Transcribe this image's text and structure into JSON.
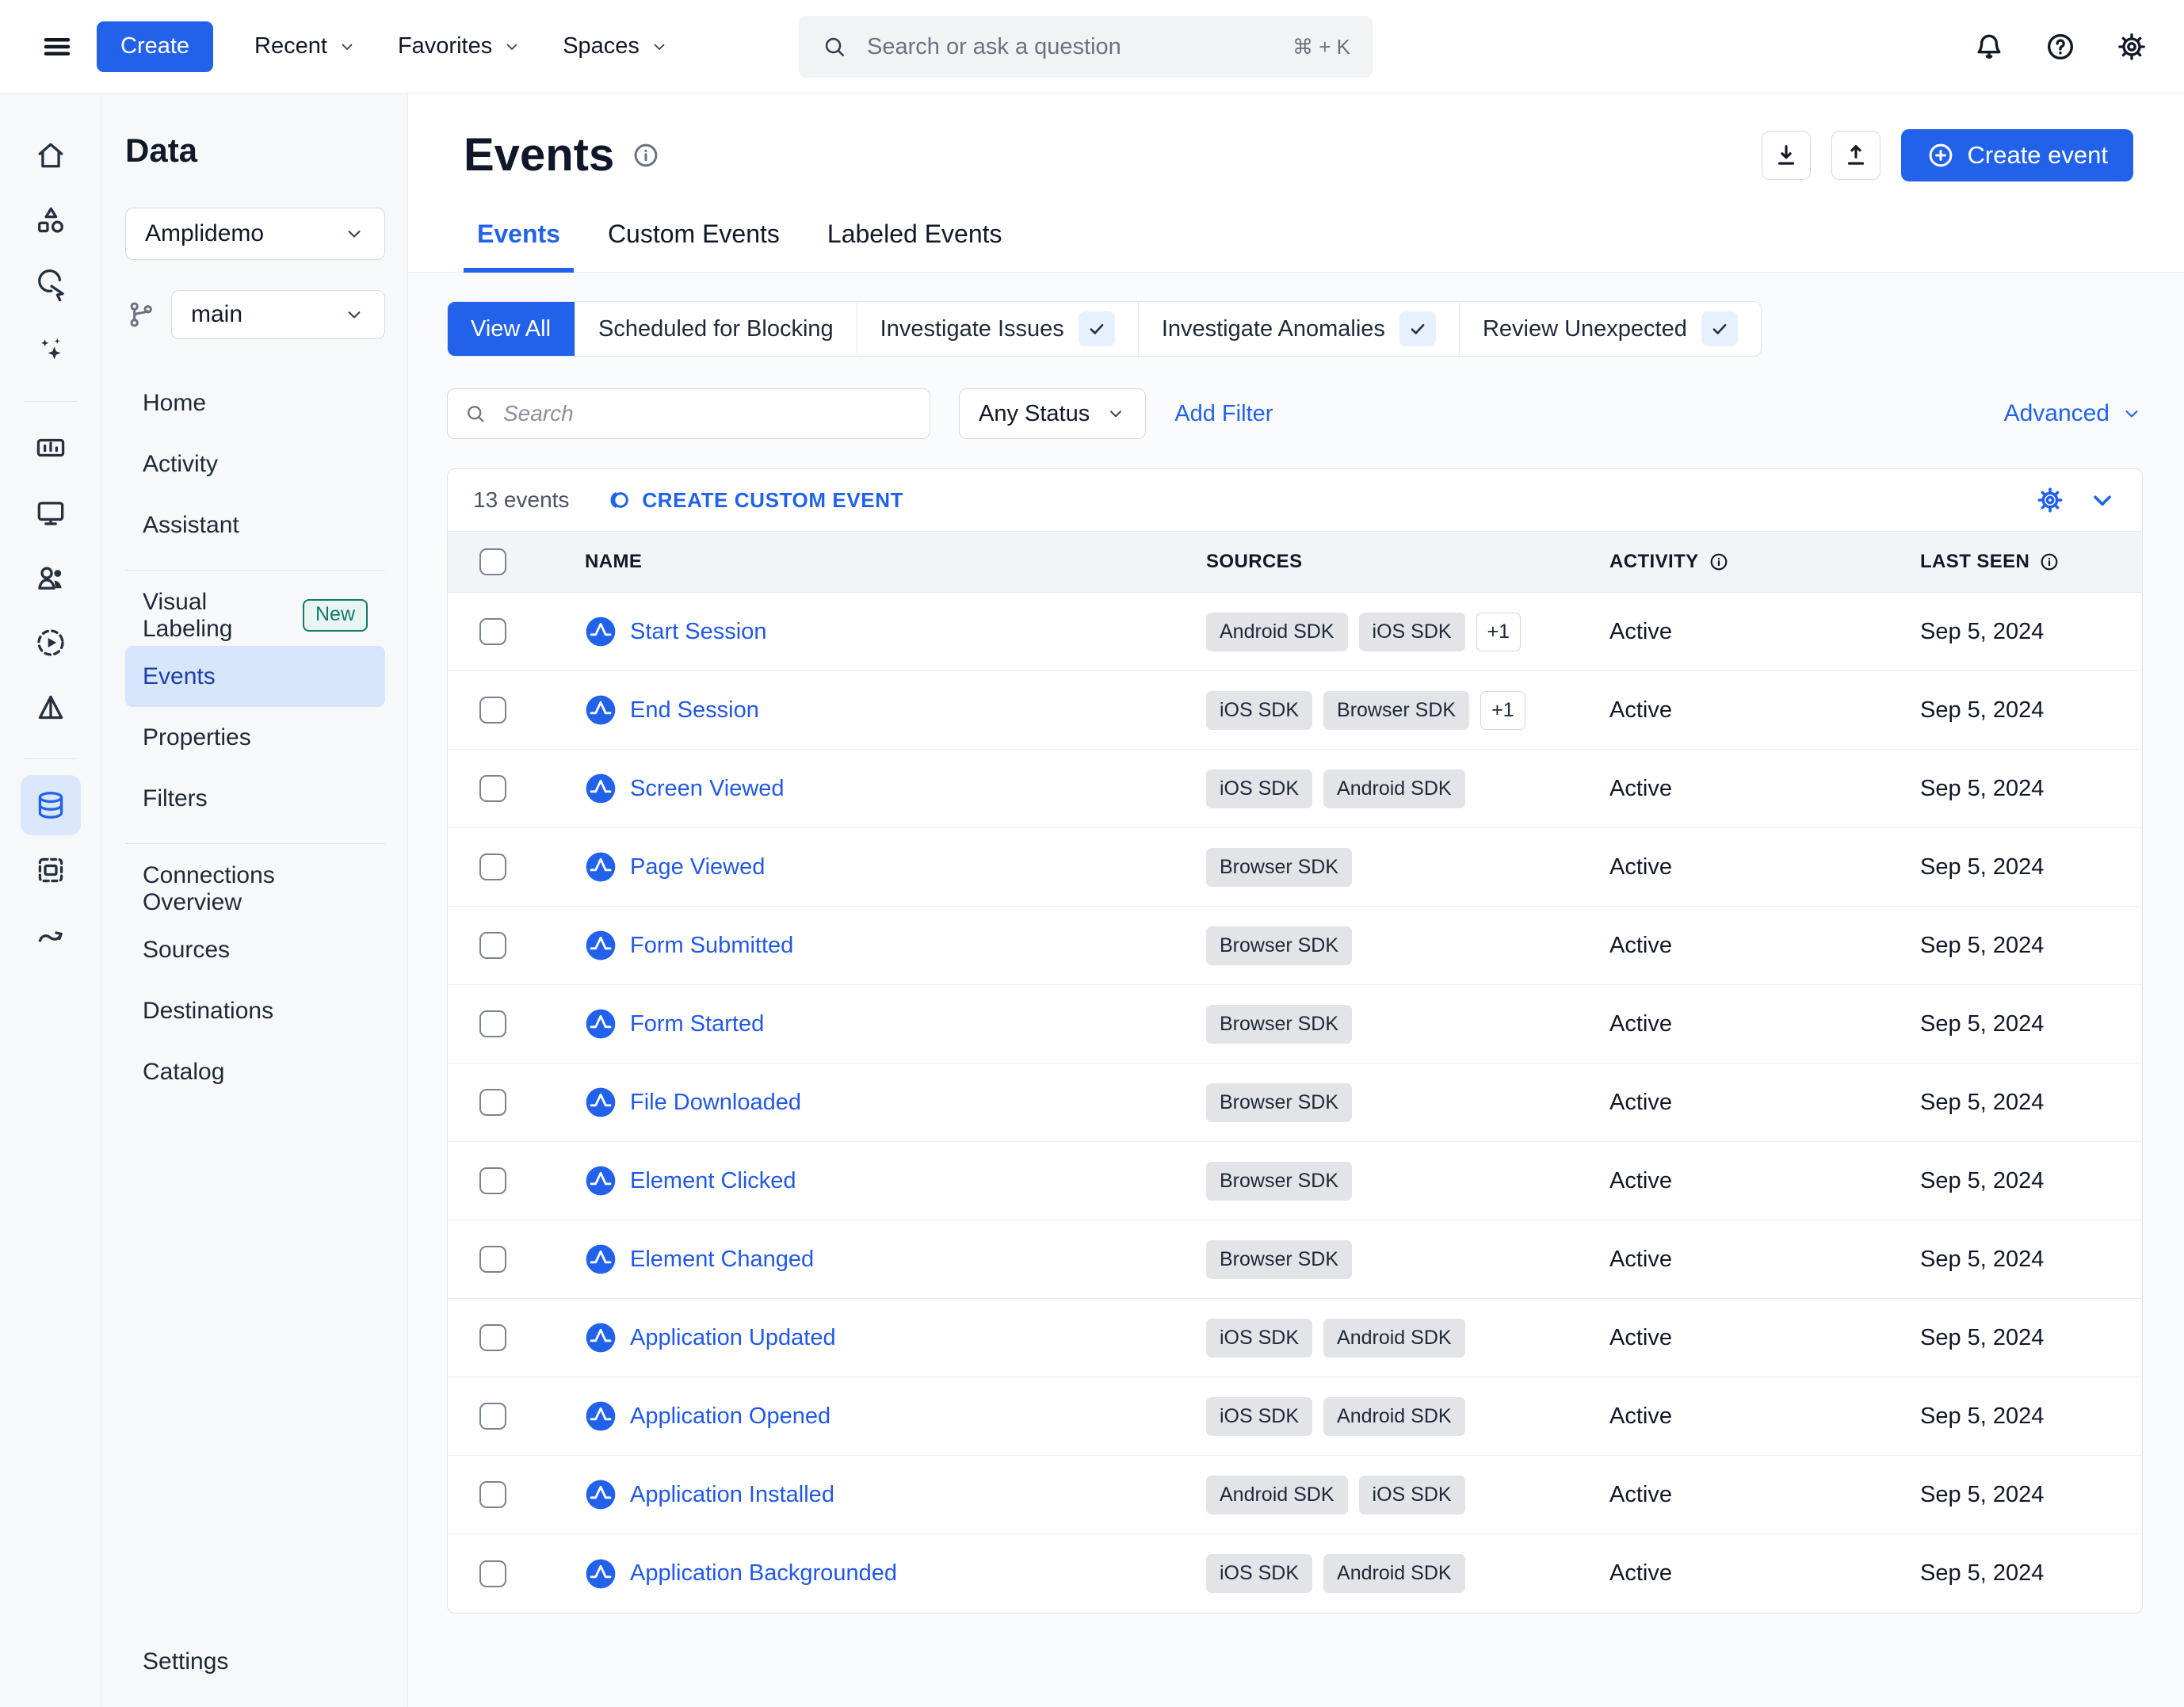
{
  "topbar": {
    "create_label": "Create",
    "nav": [
      {
        "label": "Recent"
      },
      {
        "label": "Favorites"
      },
      {
        "label": "Spaces"
      }
    ],
    "search_placeholder": "Search or ask a question",
    "search_shortcut": "⌘ + K",
    "right_icons": [
      "bell-icon",
      "help-icon",
      "gear-icon"
    ]
  },
  "rail": {
    "items": [
      {
        "icon": "home"
      },
      {
        "icon": "objects"
      },
      {
        "icon": "pointer-click"
      },
      {
        "icon": "ai-sparkles"
      },
      {
        "divider": true
      },
      {
        "icon": "charts"
      },
      {
        "icon": "displays"
      },
      {
        "icon": "users"
      },
      {
        "icon": "session-replay"
      },
      {
        "icon": "experiment"
      },
      {
        "divider": true
      },
      {
        "icon": "data",
        "active": true
      },
      {
        "icon": "labels"
      },
      {
        "icon": "journeys"
      }
    ]
  },
  "sidebar": {
    "title": "Data",
    "project": "Amplidemo",
    "branch": "main",
    "items": [
      {
        "label": "Home"
      },
      {
        "label": "Activity"
      },
      {
        "label": "Assistant"
      },
      {
        "divider": true
      },
      {
        "label": "Visual Labeling",
        "badge": "New"
      },
      {
        "label": "Events",
        "active": true
      },
      {
        "label": "Properties"
      },
      {
        "label": "Filters"
      },
      {
        "divider": true
      },
      {
        "label": "Connections Overview"
      },
      {
        "label": "Sources"
      },
      {
        "label": "Destinations"
      },
      {
        "label": "Catalog"
      }
    ],
    "settings_label": "Settings"
  },
  "page": {
    "title": "Events",
    "create_event_label": "Create event",
    "tabs": [
      {
        "label": "Events",
        "active": true
      },
      {
        "label": "Custom Events"
      },
      {
        "label": "Labeled Events"
      }
    ]
  },
  "filters": {
    "segments": [
      {
        "label": "View All",
        "active": true
      },
      {
        "label": "Scheduled for Blocking"
      },
      {
        "label": "Investigate Issues",
        "check": true
      },
      {
        "label": "Investigate Anomalies",
        "check": true
      },
      {
        "label": "Review Unexpected",
        "check": true
      }
    ],
    "search_placeholder": "Search",
    "status_label": "Any Status",
    "add_filter_label": "Add Filter",
    "advanced_label": "Advanced"
  },
  "table": {
    "count_label": "13 events",
    "create_custom_label": "CREATE CUSTOM EVENT",
    "columns": [
      "NAME",
      "SOURCES",
      "ACTIVITY",
      "LAST SEEN"
    ],
    "rows": [
      {
        "name": "Start Session",
        "sources": [
          "Android SDK",
          "iOS SDK"
        ],
        "more": "+1",
        "activity": "Active",
        "last_seen": "Sep 5, 2024"
      },
      {
        "name": "End Session",
        "sources": [
          "iOS SDK",
          "Browser SDK"
        ],
        "more": "+1",
        "activity": "Active",
        "last_seen": "Sep 5, 2024"
      },
      {
        "name": "Screen Viewed",
        "sources": [
          "iOS SDK",
          "Android SDK"
        ],
        "activity": "Active",
        "last_seen": "Sep 5, 2024"
      },
      {
        "name": "Page Viewed",
        "sources": [
          "Browser SDK"
        ],
        "activity": "Active",
        "last_seen": "Sep 5, 2024"
      },
      {
        "name": "Form Submitted",
        "sources": [
          "Browser SDK"
        ],
        "activity": "Active",
        "last_seen": "Sep 5, 2024"
      },
      {
        "name": "Form Started",
        "sources": [
          "Browser SDK"
        ],
        "activity": "Active",
        "last_seen": "Sep 5, 2024"
      },
      {
        "name": "File Downloaded",
        "sources": [
          "Browser SDK"
        ],
        "activity": "Active",
        "last_seen": "Sep 5, 2024"
      },
      {
        "name": "Element Clicked",
        "sources": [
          "Browser SDK"
        ],
        "activity": "Active",
        "last_seen": "Sep 5, 2024"
      },
      {
        "name": "Element Changed",
        "sources": [
          "Browser SDK"
        ],
        "activity": "Active",
        "last_seen": "Sep 5, 2024"
      },
      {
        "name": "Application Updated",
        "sources": [
          "iOS SDK",
          "Android SDK"
        ],
        "activity": "Active",
        "last_seen": "Sep 5, 2024"
      },
      {
        "name": "Application Opened",
        "sources": [
          "iOS SDK",
          "Android SDK"
        ],
        "activity": "Active",
        "last_seen": "Sep 5, 2024"
      },
      {
        "name": "Application Installed",
        "sources": [
          "Android SDK",
          "iOS SDK"
        ],
        "activity": "Active",
        "last_seen": "Sep 5, 2024"
      },
      {
        "name": "Application Backgrounded",
        "sources": [
          "iOS SDK",
          "Android SDK"
        ],
        "activity": "Active",
        "last_seen": "Sep 5, 2024"
      }
    ]
  },
  "colors": {
    "accent": "#2262eb",
    "link": "#2158e8",
    "teal_badge": "#117a6f"
  }
}
